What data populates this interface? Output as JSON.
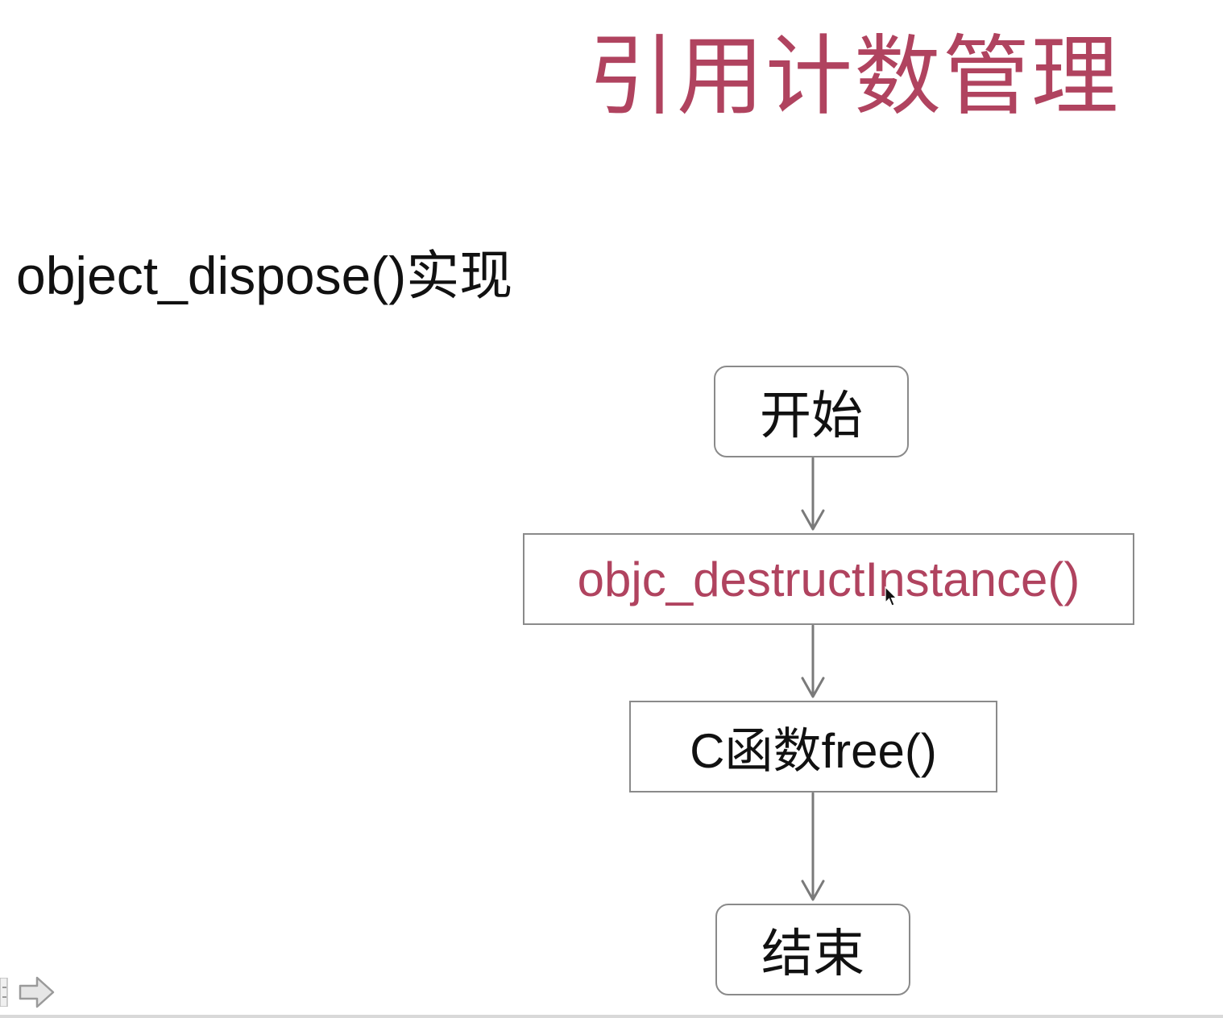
{
  "slide": {
    "title": "引用计数管理",
    "subtitle": "object_dispose()实现"
  },
  "flowchart": {
    "nodes": [
      {
        "id": "start",
        "label": "开始"
      },
      {
        "id": "destruct",
        "label": "objc_destructInstance()"
      },
      {
        "id": "free",
        "label": "C函数free()"
      },
      {
        "id": "end",
        "label": "结束"
      }
    ]
  },
  "colors": {
    "accent": "#b0435f",
    "text": "#111111",
    "border": "#8a8a8a",
    "arrow": "#7a7a7a"
  },
  "icons": {
    "cursor": "mouse-pointer-icon",
    "prev": "previous-slide-icon",
    "next": "next-slide-arrow-icon"
  }
}
